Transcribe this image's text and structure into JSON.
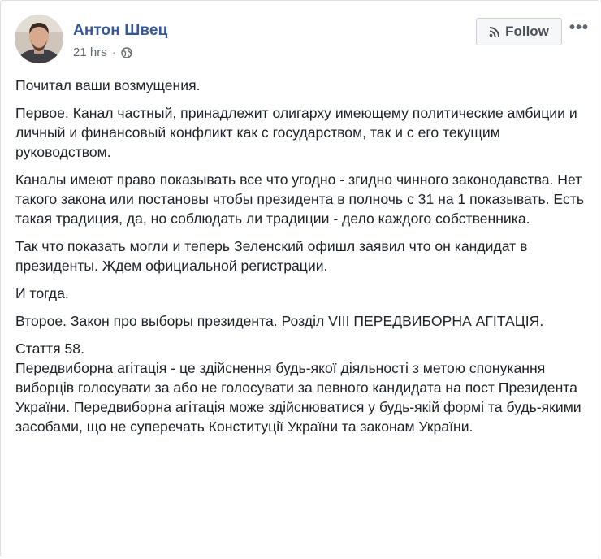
{
  "post": {
    "author": "Антон Швец",
    "timestamp": "21 hrs",
    "privacy_icon": "globe-icon",
    "follow_label": "Follow",
    "follow_icon": "rss-icon",
    "more_label": "•••",
    "paragraphs": [
      "Почитал ваши возмущения.",
      "Первое. Канал частный, принадлежит олигарху имеющему политические амбиции и личный и финансовый конфликт как с государством, так и с его текущим руководством.",
      "Каналы имеют право показывать все что угодно - згидно чинного законодавства. Нет такого закона или постановы чтобы президента в полночь с 31 на 1 показывать. Есть такая традиция, да, но соблюдать ли традиции - дело каждого собственника.",
      "Так что показать могли и теперь Зеленский офишл заявил что он кандидат в президенты. Ждем официальной регистрации.",
      "И тогда.",
      "Второе. Закон про выборы президента. Розділ VIII ПЕРЕДВИБОРНА АГІТАЦІЯ."
    ],
    "article_title": "Стаття 58.",
    "article_text": "Передвиборна агітація - це здійснення будь-якої діяльності з метою спонукання виборців голосувати за або не голосувати за певного кандидата на пост Президента України. Передвиборна агітація може здійснюватися у будь-якій формі та будь-якими засобами, що не суперечать Конституції України та законам України."
  }
}
